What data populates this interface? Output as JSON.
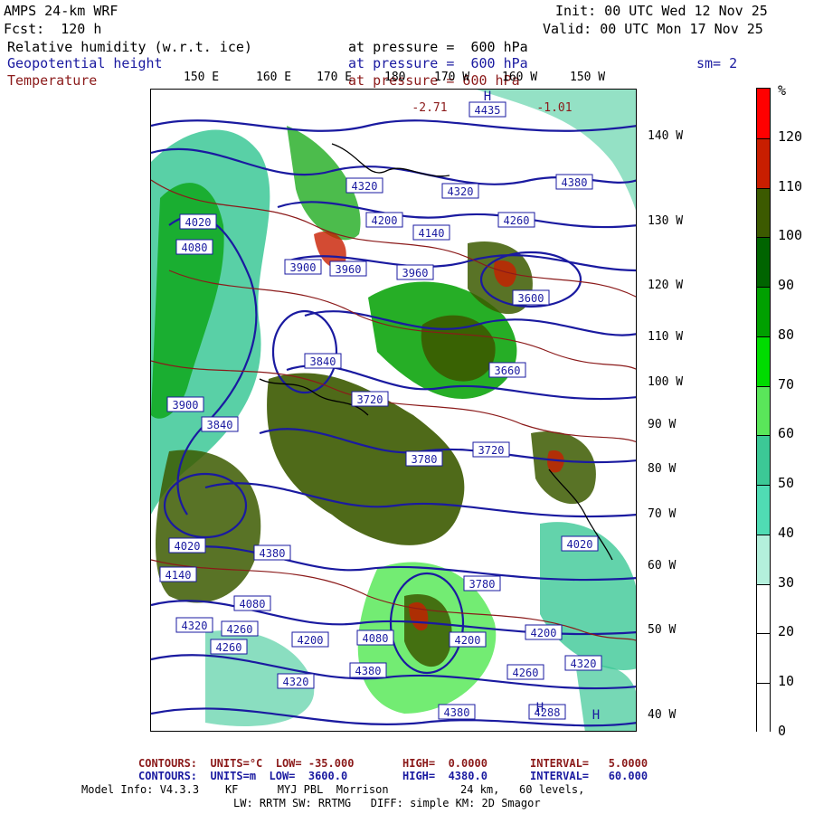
{
  "header": {
    "model": "AMPS 24-km WRF",
    "forecast": "Fcst:  120 h",
    "init": "Init: 00 UTC Wed 12 Nov 25",
    "valid": "Valid: 00 UTC Mon 17 Nov 25"
  },
  "fields": [
    {
      "name": "Relative humidity (w.r.t. ice)",
      "level": "at pressure =  600 hPa",
      "color": "#000000"
    },
    {
      "name": "Geopotential height",
      "level": "at pressure =  600 hPa",
      "color": "#1a1aa0"
    },
    {
      "name": "Temperature",
      "level": "at pressure = 600 hPa",
      "color": "#8b1a1a"
    }
  ],
  "smoothing": "sm= 2",
  "longitude_labels": [
    "150 E",
    "160 E",
    "170 E",
    "180",
    "170 W",
    "160 W",
    "150 W"
  ],
  "latitude_labels": [
    "140 W",
    "130 W",
    "120 W",
    "110 W",
    "100 W",
    "90 W",
    "80 W",
    "70 W",
    "60 W",
    "50 W",
    "40 W"
  ],
  "colorbar": {
    "unit": "%",
    "ticks": [
      "120",
      "110",
      "100",
      "90",
      "80",
      "70",
      "60",
      "50",
      "40",
      "30",
      "20",
      "10",
      "0"
    ],
    "bands": [
      {
        "from": 120,
        "color": "#ff0000"
      },
      {
        "from": 110,
        "color": "#c81e00"
      },
      {
        "from": 100,
        "color": "#3c5a00"
      },
      {
        "from": 90,
        "color": "#006400"
      },
      {
        "from": 80,
        "color": "#00a000"
      },
      {
        "from": 70,
        "color": "#00dc00"
      },
      {
        "from": 60,
        "color": "#5ae65a"
      },
      {
        "from": 50,
        "color": "#3cc896"
      },
      {
        "from": 40,
        "color": "#50dcb4"
      },
      {
        "from": 30,
        "color": "#b4f0dc"
      },
      {
        "from": 20,
        "color": "#ffffff"
      },
      {
        "from": 10,
        "color": "#ffffff"
      },
      {
        "from": 0,
        "color": "#ffffff"
      }
    ]
  },
  "height_labels": [
    "4435",
    "4320",
    "4320",
    "4380",
    "4260",
    "4200",
    "4140",
    "4080",
    "4020",
    "3960",
    "3900",
    "3840",
    "3780",
    "3720",
    "3660",
    "3600",
    "3840",
    "3720",
    "3780",
    "4020",
    "4080",
    "4200",
    "4260",
    "4320",
    "4380",
    "4140",
    "4020",
    "3900",
    "3960",
    "4320",
    "4200",
    "4260",
    "4380",
    "4080",
    "4200",
    "4320",
    "4260",
    "4200",
    "4380",
    "4288"
  ],
  "highs": [
    "H",
    "H",
    "H"
  ],
  "temp_labels": [
    "-2.71",
    "-1.01"
  ],
  "footer": {
    "line1": {
      "label": "CONTOURS:  UNITS=°C  LOW= -35.000",
      "high": "HIGH=  0.0000",
      "interval": "INTERVAL=   5.0000"
    },
    "line2": {
      "label": "CONTOURS:  UNITS=m  LOW=  3600.0",
      "high": "HIGH=  4380.0",
      "interval": "INTERVAL=   60.000"
    },
    "line3": "Model Info: V4.3.3    KF      MYJ PBL  Morrison           24 km,   60 levels,",
    "line4": "LW: RRTM SW: RRTMG   DIFF: simple KM: 2D Smagor"
  }
}
